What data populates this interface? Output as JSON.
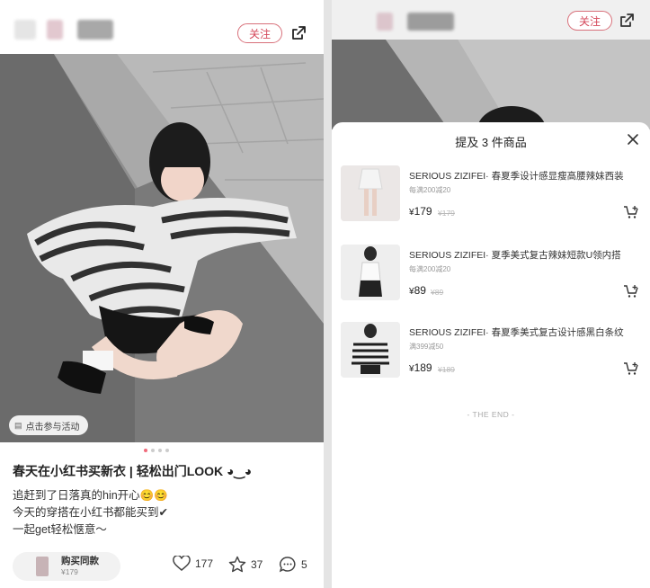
{
  "left": {
    "header": {
      "follow_label": "关注"
    },
    "photo_tag": "点击参与活动",
    "carousel": {
      "count": 4,
      "active": 1
    },
    "post": {
      "title": "春天在小红书买新衣 | 轻松出门LOOK ◕‿◕",
      "lines": [
        "追赶到了日落真的hin开心😊😊",
        "今天的穿搭在小红书都能买到✔",
        "一起get轻松惬意～"
      ]
    },
    "bottom_bar": {
      "buy_label": "购买同款",
      "buy_price": "¥179",
      "likes": "177",
      "collects": "37",
      "comments": "5"
    }
  },
  "right": {
    "header": {
      "follow_label": "关注"
    },
    "sheet": {
      "title": "提及 3 件商品",
      "products": [
        {
          "name": "SERIOUS ZIZIFEI· 春夏季设计感显瘦高腰辣妹西装",
          "promo": "每满200减20",
          "price": "179",
          "original": "¥179"
        },
        {
          "name": "SERIOUS ZIZIFEI· 夏季美式复古辣妹短款U领内搭",
          "promo": "每满200减20",
          "price": "89",
          "original": "¥89"
        },
        {
          "name": "SERIOUS ZIZIFEI· 春夏季美式复古设计感黑白条纹",
          "promo": "满399减50",
          "price": "189",
          "original": "¥189"
        }
      ],
      "end_text": "- THE END -"
    }
  }
}
